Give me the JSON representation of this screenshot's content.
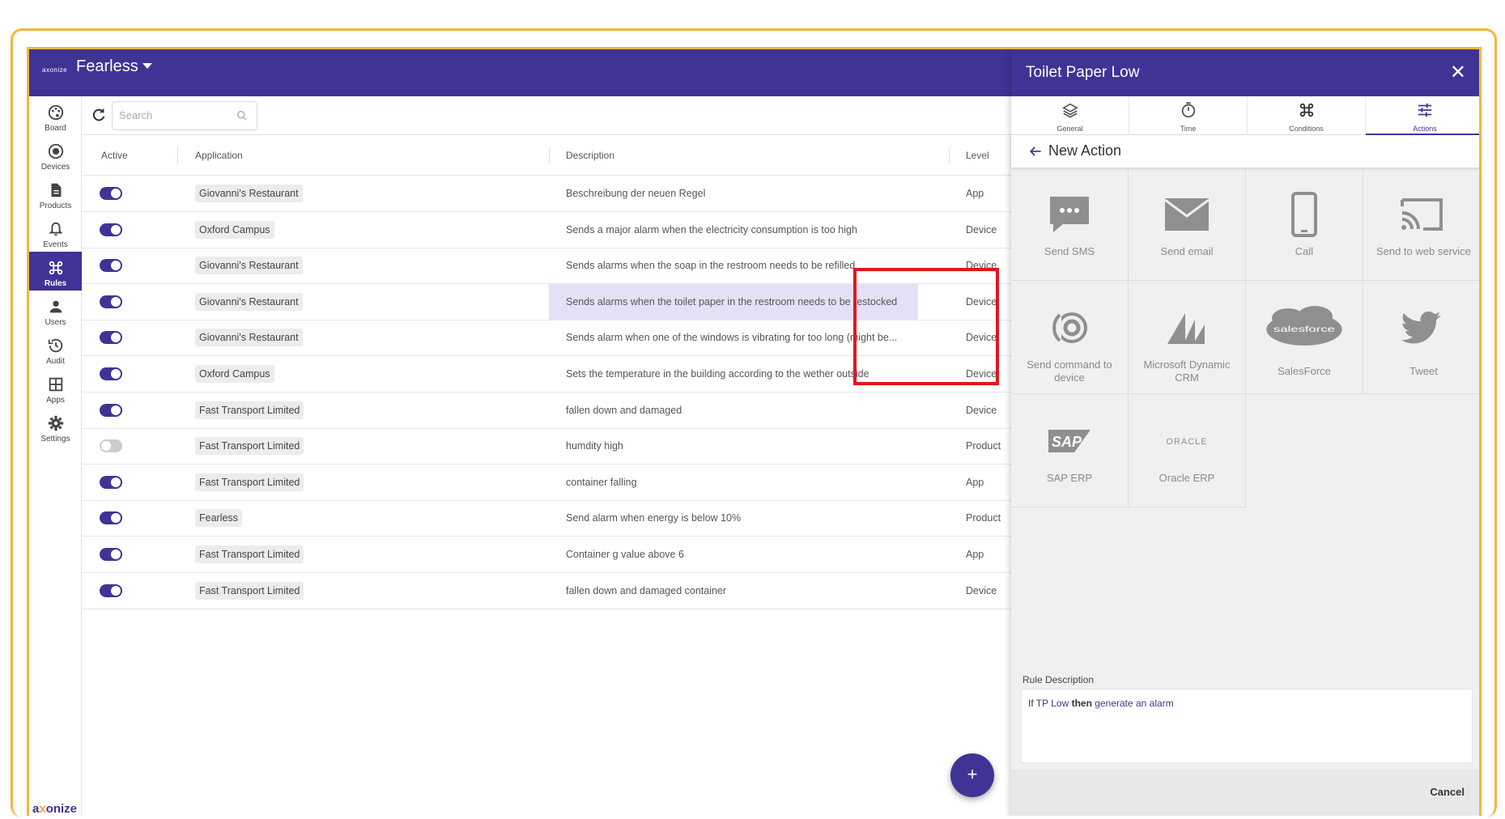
{
  "header": {
    "brand_mini": "axonize",
    "org_name": "Fearless"
  },
  "nav": [
    {
      "label": "Board",
      "icon": "palette-icon"
    },
    {
      "label": "Devices",
      "icon": "target-icon"
    },
    {
      "label": "Products",
      "icon": "document-icon"
    },
    {
      "label": "Events",
      "icon": "bell-icon"
    },
    {
      "label": "Rules",
      "icon": "command-icon",
      "active": true
    },
    {
      "label": "Users",
      "icon": "user-icon"
    },
    {
      "label": "Audit",
      "icon": "history-icon"
    },
    {
      "label": "Apps",
      "icon": "grid-icon"
    },
    {
      "label": "Settings",
      "icon": "gear-icon"
    }
  ],
  "bottom_logo": {
    "a": "a",
    "x": "x",
    "rest": "onize"
  },
  "search": {
    "placeholder": "Search"
  },
  "table": {
    "headers": [
      "Active",
      "Application",
      "Description",
      "Level"
    ],
    "rows": [
      {
        "active": true,
        "application": "Giovanni's Restaurant",
        "description": "Beschreibung der neuen Regel",
        "level": "App"
      },
      {
        "active": true,
        "application": "Oxford Campus",
        "description": "Sends a major alarm when the electricity consumption is too high",
        "level": "Device"
      },
      {
        "active": true,
        "application": "Giovanni's Restaurant",
        "description": "Sends alarms when the soap in the restroom needs to be refilled",
        "level": "Device"
      },
      {
        "active": true,
        "application": "Giovanni's Restaurant",
        "description": "Sends alarms when the toilet paper in the restroom needs to be restocked",
        "level": "Device",
        "selected": true
      },
      {
        "active": true,
        "application": "Giovanni's Restaurant",
        "description": "Sends alarm when one of the windows is vibrating for too long (might be...",
        "level": "Device"
      },
      {
        "active": true,
        "application": "Oxford Campus",
        "description": "Sets the temperature in the building according to the wether outside",
        "level": "Device"
      },
      {
        "active": true,
        "application": "Fast Transport Limited",
        "description": "fallen down and damaged",
        "level": "Device"
      },
      {
        "active": false,
        "application": "Fast Transport Limited",
        "description": "humdity high",
        "level": "Product"
      },
      {
        "active": true,
        "application": "Fast Transport Limited",
        "description": "container falling",
        "level": "App"
      },
      {
        "active": true,
        "application": "Fearless",
        "description": "Send alarm when energy is below 10%",
        "level": "Product"
      },
      {
        "active": true,
        "application": "Fast Transport Limited",
        "description": "Container g value above 6",
        "level": "App"
      },
      {
        "active": true,
        "application": "Fast Transport Limited",
        "description": "fallen down and damaged container",
        "level": "Device"
      }
    ]
  },
  "fab": {
    "label": "+"
  },
  "panel": {
    "title": "Toilet Paper Low",
    "close": "✕",
    "tabs": [
      {
        "label": "General",
        "icon": "layers-icon"
      },
      {
        "label": "Time",
        "icon": "stopwatch-icon"
      },
      {
        "label": "Conditions",
        "icon": "command-icon"
      },
      {
        "label": "Actions",
        "icon": "sliders-icon",
        "active": true
      }
    ],
    "new_action_label": "New Action",
    "actions": [
      {
        "label": "Send SMS",
        "icon": "sms-icon"
      },
      {
        "label": "Send email",
        "icon": "email-icon"
      },
      {
        "label": "Call",
        "icon": "phone-icon"
      },
      {
        "label": "Send to web service",
        "icon": "cast-icon"
      },
      {
        "label": "Send command to device",
        "icon": "broadcast-icon"
      },
      {
        "label": "Microsoft Dynamic CRM",
        "icon": "microsoft-dynamics-logo"
      },
      {
        "label": "SalesForce",
        "icon": "salesforce-logo",
        "logo_text": "salesforce"
      },
      {
        "label": "Tweet",
        "icon": "twitter-bird-icon"
      },
      {
        "label": "SAP ERP",
        "icon": "sap-logo",
        "logo_text": "SAP"
      },
      {
        "label": "Oracle ERP",
        "icon": "oracle-logo",
        "logo_text": "ORACLE"
      }
    ],
    "rule_description_label": "Rule Description",
    "rule_description": {
      "if": "If",
      "cond": "TP Low",
      "then": "then",
      "action": "generate an alarm"
    },
    "cancel_label": "Cancel"
  },
  "colors": {
    "primary": "#3e3496",
    "frame": "#f8b43c",
    "highlight": "#e3161d"
  }
}
